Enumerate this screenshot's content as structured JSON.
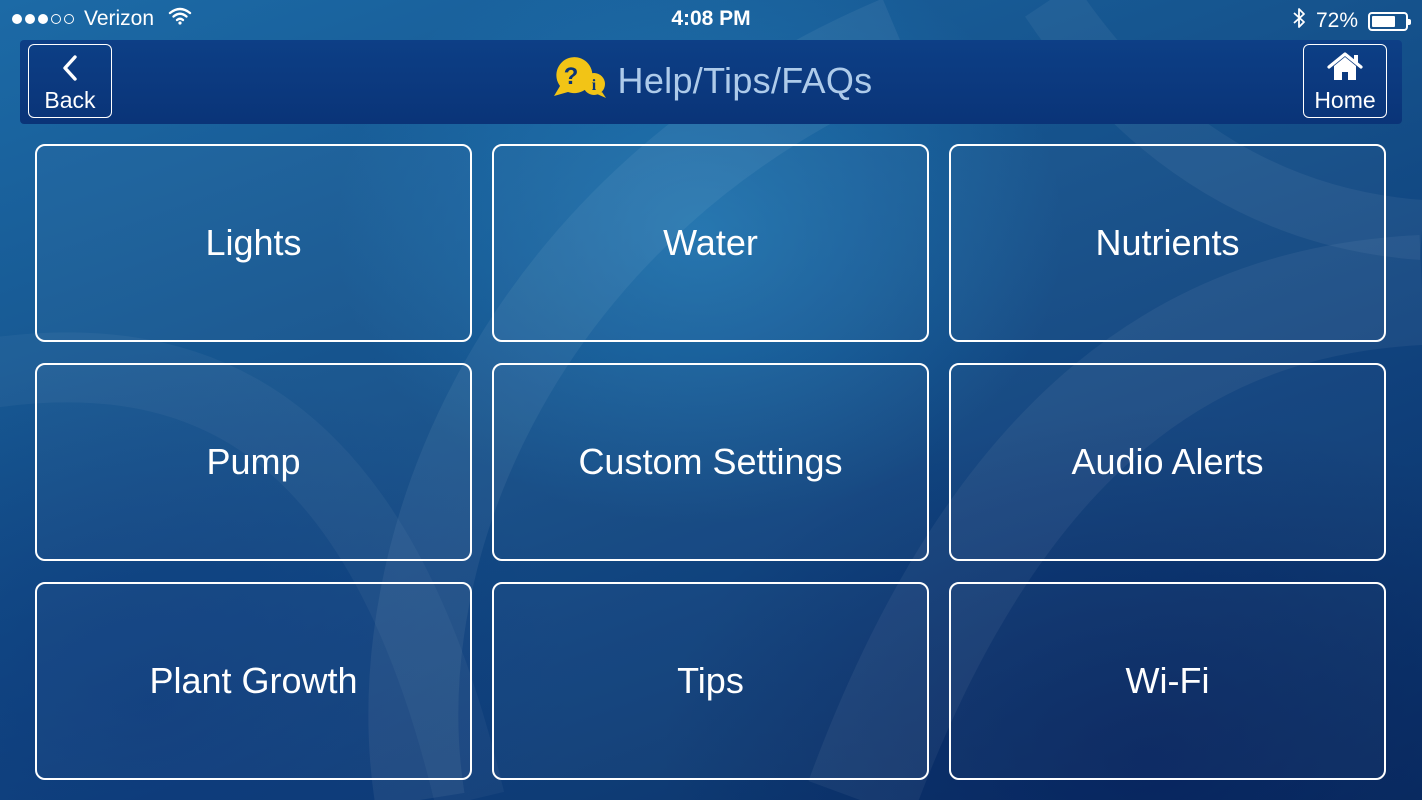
{
  "status_bar": {
    "carrier": "Verizon",
    "time": "4:08 PM",
    "battery": "72%",
    "battery_level": 0.72
  },
  "header": {
    "back_label": "Back",
    "home_label": "Home",
    "title": "Help/Tips/FAQs"
  },
  "menu": [
    {
      "label": "Lights"
    },
    {
      "label": "Water"
    },
    {
      "label": "Nutrients"
    },
    {
      "label": "Pump"
    },
    {
      "label": "Custom Settings"
    },
    {
      "label": "Audio Alerts"
    },
    {
      "label": "Plant Growth"
    },
    {
      "label": "Tips"
    },
    {
      "label": "Wi-Fi"
    }
  ],
  "colors": {
    "header_bg": "#0d3f86",
    "title_text": "#aecbea",
    "help_icon": "#f2c416"
  },
  "icons": {
    "signal": "signal-dots-icon",
    "wifi": "wifi-icon",
    "bluetooth": "bluetooth-icon",
    "battery": "battery-icon",
    "back": "chevron-left-icon",
    "home": "home-icon",
    "help": "help-info-bubble-icon"
  }
}
